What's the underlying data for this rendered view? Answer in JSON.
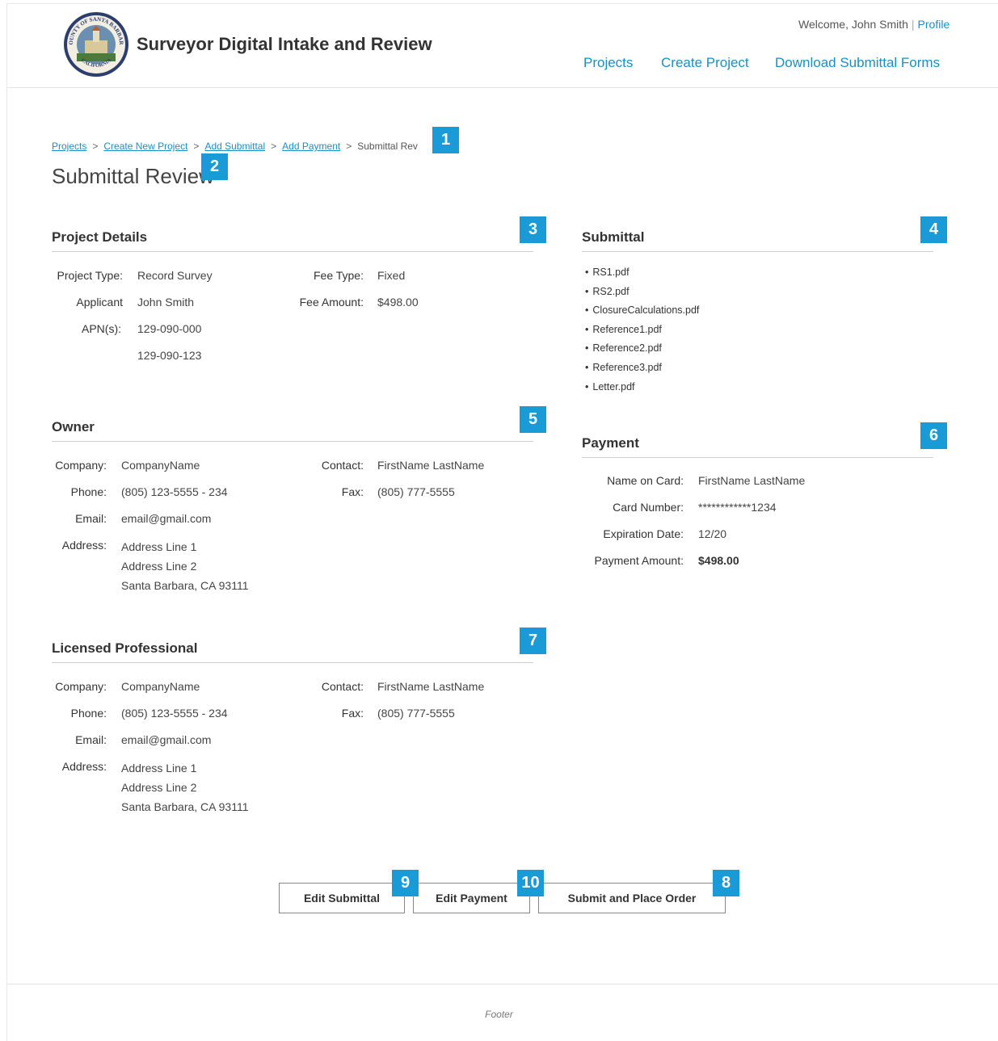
{
  "header": {
    "app_title": "Surveyor Digital Intake and Review",
    "welcome_text": "Welcome, John Smith",
    "separator": "|",
    "profile_link": "Profile",
    "logo_top_text": "COUNTY OF SANTA BARBARA",
    "logo_bottom_text": "CALIFORNIA",
    "nav": [
      "Projects",
      "Create Project",
      "Download Submittal Forms"
    ]
  },
  "breadcrumb": {
    "links": [
      "Projects",
      "Create New Project",
      "Add Submittal",
      "Add Payment"
    ],
    "current": "Submittal Rev",
    "separator": ">"
  },
  "page_title": "Submittal Review",
  "markers": [
    "1",
    "2",
    "3",
    "4",
    "5",
    "6",
    "7",
    "8",
    "9",
    "10"
  ],
  "project_details": {
    "title": "Project Details",
    "project_type_label": "Project Type:",
    "project_type": "Record Survey",
    "applicant_label": "Applicant",
    "applicant": "John Smith",
    "apn_label": "APN(s):",
    "apns": [
      "129-090-000",
      "129-090-123"
    ],
    "fee_type_label": "Fee Type:",
    "fee_type": "Fixed",
    "fee_amount_label": "Fee Amount:",
    "fee_amount": "$498.00"
  },
  "submittal": {
    "title": "Submittal",
    "files": [
      "RS1.pdf",
      "RS2.pdf",
      "ClosureCalculations.pdf",
      "Reference1.pdf",
      "Reference2.pdf",
      "Reference3.pdf",
      "Letter.pdf"
    ]
  },
  "owner": {
    "title": "Owner",
    "company_label": "Company:",
    "company": "CompanyName",
    "phone_label": "Phone:",
    "phone": "(805) 123-5555 - 234",
    "email_label": "Email:",
    "email": "email@gmail.com",
    "address_label": "Address:",
    "address": [
      "Address Line 1",
      "Address Line 2",
      "Santa Barbara, CA 93111"
    ],
    "contact_label": "Contact:",
    "contact": "FirstName LastName",
    "fax_label": "Fax:",
    "fax": "(805) 777-5555"
  },
  "payment": {
    "title": "Payment",
    "name_label": "Name on Card:",
    "name": "FirstName LastName",
    "card_label": "Card Number:",
    "card": "************1234",
    "exp_label": "Expiration Date:",
    "exp": "12/20",
    "amount_label": "Payment Amount:",
    "amount": "$498.00"
  },
  "licensed_professional": {
    "title": "Licensed Professional",
    "company_label": "Company:",
    "company": "CompanyName",
    "phone_label": "Phone:",
    "phone": "(805) 123-5555 - 234",
    "email_label": "Email:",
    "email": "email@gmail.com",
    "address_label": "Address:",
    "address": [
      "Address Line 1",
      "Address Line 2",
      "Santa Barbara, CA 93111"
    ],
    "contact_label": "Contact:",
    "contact": "FirstName LastName",
    "fax_label": "Fax:",
    "fax": "(805) 777-5555"
  },
  "actions": {
    "edit_submittal": "Edit Submittal",
    "edit_payment": "Edit Payment",
    "submit": "Submit and Place Order"
  },
  "footer": "Footer",
  "colors": {
    "link": "#1a8fc2",
    "marker": "#1a9ad6",
    "rule": "#cfcfcf"
  }
}
